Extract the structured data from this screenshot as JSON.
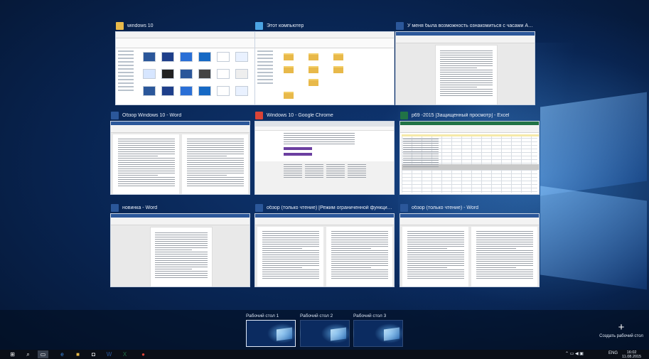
{
  "windows": [
    {
      "title": "windows 10",
      "icon": "folder-icon",
      "icon_color": "#e8b94a",
      "kind": "explorer"
    },
    {
      "title": "Этот компьютер",
      "icon": "computer-icon",
      "icon_color": "#4ba3e3",
      "kind": "thispc"
    },
    {
      "title": "У меня была возможность ознакомиться с часами Apple Watch...",
      "icon": "word-icon",
      "icon_color": "#2b579a",
      "kind": "word"
    },
    {
      "title": "Обзор Windows 10 - Word",
      "icon": "word-icon",
      "icon_color": "#2b579a",
      "kind": "word2"
    },
    {
      "title": "Windows 10 - Google Chrome",
      "icon": "chrome-icon",
      "icon_color": "#db4437",
      "kind": "chrome"
    },
    {
      "title": "p69 -2015 [Защищенный просмотр] - Excel",
      "icon": "excel-icon",
      "icon_color": "#217346",
      "kind": "excel"
    },
    {
      "title": "новинка - Word",
      "icon": "word-icon",
      "icon_color": "#2b579a",
      "kind": "word"
    },
    {
      "title": "обзор (только чтение) [Режим ограниченной функциональност...",
      "icon": "word-icon",
      "icon_color": "#2b579a",
      "kind": "word2"
    },
    {
      "title": "обзор (только чтение) - Word",
      "icon": "word-icon",
      "icon_color": "#2b579a",
      "kind": "word2"
    }
  ],
  "desktops": [
    {
      "label": "Рабочий стол 1",
      "active": true
    },
    {
      "label": "Рабочий стол 2",
      "active": false
    },
    {
      "label": "Рабочий стол 3",
      "active": false
    }
  ],
  "new_desktop": {
    "icon": "plus-icon",
    "label": "Создать рабочий стол"
  },
  "taskbar": {
    "items": [
      {
        "name": "start-icon",
        "glyph": "⊞",
        "color": "#ffffff"
      },
      {
        "name": "search-icon",
        "glyph": "⌕",
        "color": "#ffffff"
      },
      {
        "name": "task-view-icon",
        "glyph": "▭",
        "color": "#ffffff",
        "pressed": true
      },
      {
        "name": "edge-icon",
        "glyph": "e",
        "color": "#3c8ce7"
      },
      {
        "name": "file-explorer-icon",
        "glyph": "■",
        "color": "#e8b94a"
      },
      {
        "name": "store-icon",
        "glyph": "◘",
        "color": "#ffffff"
      },
      {
        "name": "word-taskbar-icon",
        "glyph": "W",
        "color": "#2b579a"
      },
      {
        "name": "excel-taskbar-icon",
        "glyph": "X",
        "color": "#217346"
      },
      {
        "name": "chrome-taskbar-icon",
        "glyph": "●",
        "color": "#db4437"
      }
    ],
    "tray": {
      "language": "ENG",
      "time": "16:02",
      "date": "11.08.2015"
    }
  },
  "colors": {
    "accent": "#0078d7",
    "taskbar": "#0b0f17"
  }
}
